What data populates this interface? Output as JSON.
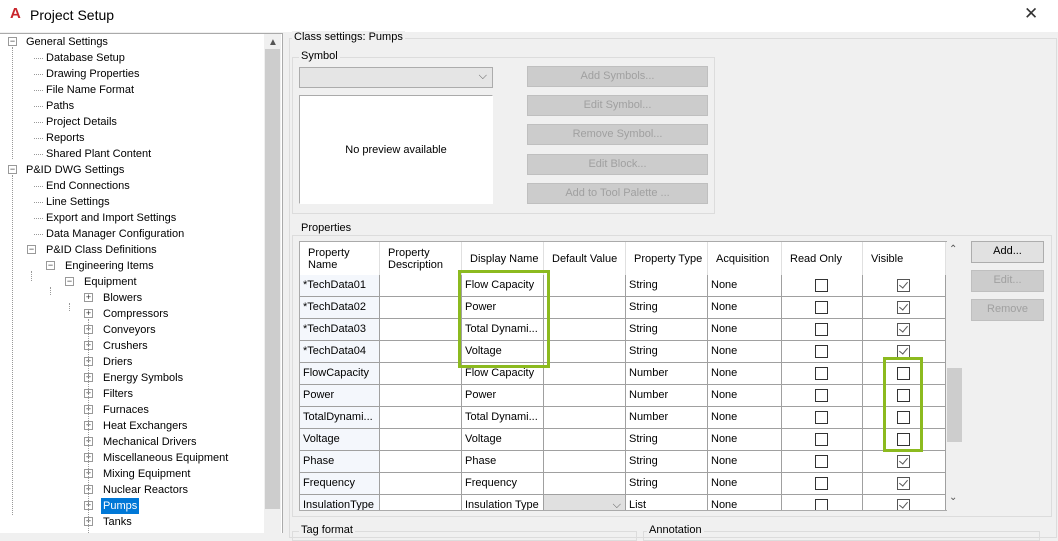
{
  "window": {
    "title": "Project Setup",
    "close_icon": "close-icon",
    "app_icon": "autocad-a-icon"
  },
  "tree": {
    "items": [
      {
        "label": "General Settings",
        "level": 0,
        "expander": "minus"
      },
      {
        "label": "Database Setup",
        "level": 1
      },
      {
        "label": "Drawing Properties",
        "level": 1
      },
      {
        "label": "File Name Format",
        "level": 1
      },
      {
        "label": "Paths",
        "level": 1
      },
      {
        "label": "Project Details",
        "level": 1
      },
      {
        "label": "Reports",
        "level": 1
      },
      {
        "label": "Shared Plant Content",
        "level": 1
      },
      {
        "label": "P&ID DWG Settings",
        "level": 0,
        "expander": "minus"
      },
      {
        "label": "End Connections",
        "level": 1
      },
      {
        "label": "Line Settings",
        "level": 1
      },
      {
        "label": "Export and Import Settings",
        "level": 1
      },
      {
        "label": "Data Manager Configuration",
        "level": 1
      },
      {
        "label": "P&ID Class Definitions",
        "level": 1,
        "expander": "minus"
      },
      {
        "label": "Engineering Items",
        "level": 2,
        "expander": "minus"
      },
      {
        "label": "Equipment",
        "level": 3,
        "expander": "minus"
      },
      {
        "label": "Blowers",
        "level": 4,
        "expander": "plus"
      },
      {
        "label": "Compressors",
        "level": 4,
        "expander": "plus"
      },
      {
        "label": "Conveyors",
        "level": 4,
        "expander": "plus"
      },
      {
        "label": "Crushers",
        "level": 4,
        "expander": "plus"
      },
      {
        "label": "Driers",
        "level": 4,
        "expander": "plus"
      },
      {
        "label": "Energy Symbols",
        "level": 4,
        "expander": "plus"
      },
      {
        "label": "Filters",
        "level": 4,
        "expander": "plus"
      },
      {
        "label": "Furnaces",
        "level": 4,
        "expander": "plus"
      },
      {
        "label": "Heat Exchangers",
        "level": 4,
        "expander": "plus"
      },
      {
        "label": "Mechanical Drivers",
        "level": 4,
        "expander": "plus"
      },
      {
        "label": "Miscellaneous Equipment",
        "level": 4,
        "expander": "plus"
      },
      {
        "label": "Mixing Equipment",
        "level": 4,
        "expander": "plus"
      },
      {
        "label": "Nuclear Reactors",
        "level": 4,
        "expander": "plus"
      },
      {
        "label": "Pumps",
        "level": 4,
        "expander": "plus",
        "selected": true
      },
      {
        "label": "Tanks",
        "level": 4,
        "expander": "plus"
      }
    ]
  },
  "class_settings": {
    "label": "Class settings: Pumps"
  },
  "symbol": {
    "label": "Symbol",
    "combo_value": "",
    "preview_text": "No preview available",
    "buttons": [
      "Add Symbols...",
      "Edit Symbol...",
      "Remove Symbol...",
      "Edit Block...",
      "Add to Tool Palette ..."
    ]
  },
  "properties": {
    "label": "Properties",
    "columns": [
      "Property Name",
      "Property Description",
      "Display Name",
      "Default Value",
      "Property Type",
      "Acquisition",
      "Read Only",
      "Visible"
    ],
    "rows": [
      {
        "name": "*TechData01",
        "desc": "",
        "display": "Flow Capacity",
        "default": "",
        "type": "String",
        "acq": "None",
        "read_only": false,
        "visible": true
      },
      {
        "name": "*TechData02",
        "desc": "",
        "display": "Power",
        "default": "",
        "type": "String",
        "acq": "None",
        "read_only": false,
        "visible": true
      },
      {
        "name": "*TechData03",
        "desc": "",
        "display": "Total Dynami...",
        "default": "",
        "type": "String",
        "acq": "None",
        "read_only": false,
        "visible": true
      },
      {
        "name": "*TechData04",
        "desc": "",
        "display": "Voltage",
        "default": "",
        "type": "String",
        "acq": "None",
        "read_only": false,
        "visible": true
      },
      {
        "name": "FlowCapacity",
        "desc": "",
        "display": "Flow Capacity",
        "default": "",
        "type": "Number",
        "acq": "None",
        "read_only": false,
        "visible": false
      },
      {
        "name": "Power",
        "desc": "",
        "display": "Power",
        "default": "",
        "type": "Number",
        "acq": "None",
        "read_only": false,
        "visible": false
      },
      {
        "name": "TotalDynami...",
        "desc": "",
        "display": "Total Dynami...",
        "default": "",
        "type": "Number",
        "acq": "None",
        "read_only": false,
        "visible": false
      },
      {
        "name": "Voltage",
        "desc": "",
        "display": "Voltage",
        "default": "",
        "type": "String",
        "acq": "None",
        "read_only": false,
        "visible": false
      },
      {
        "name": "Phase",
        "desc": "",
        "display": "Phase",
        "default": "",
        "type": "String",
        "acq": "None",
        "read_only": false,
        "visible": true
      },
      {
        "name": "Frequency",
        "desc": "",
        "display": "Frequency",
        "default": "",
        "type": "String",
        "acq": "None",
        "read_only": false,
        "visible": true
      },
      {
        "name": "InsulationType",
        "desc": "",
        "display": "Insulation Type",
        "default": "",
        "type": "List",
        "acq": "None",
        "read_only": false,
        "visible": true,
        "default_is_combo": true
      }
    ],
    "buttons": {
      "add": "Add...",
      "edit": "Edit...",
      "remove": "Remove"
    }
  },
  "tag_format": {
    "label": "Tag format"
  },
  "annotation": {
    "label": "Annotation"
  },
  "colors": {
    "highlight": "#8cba1f",
    "selection": "#0078d7"
  }
}
